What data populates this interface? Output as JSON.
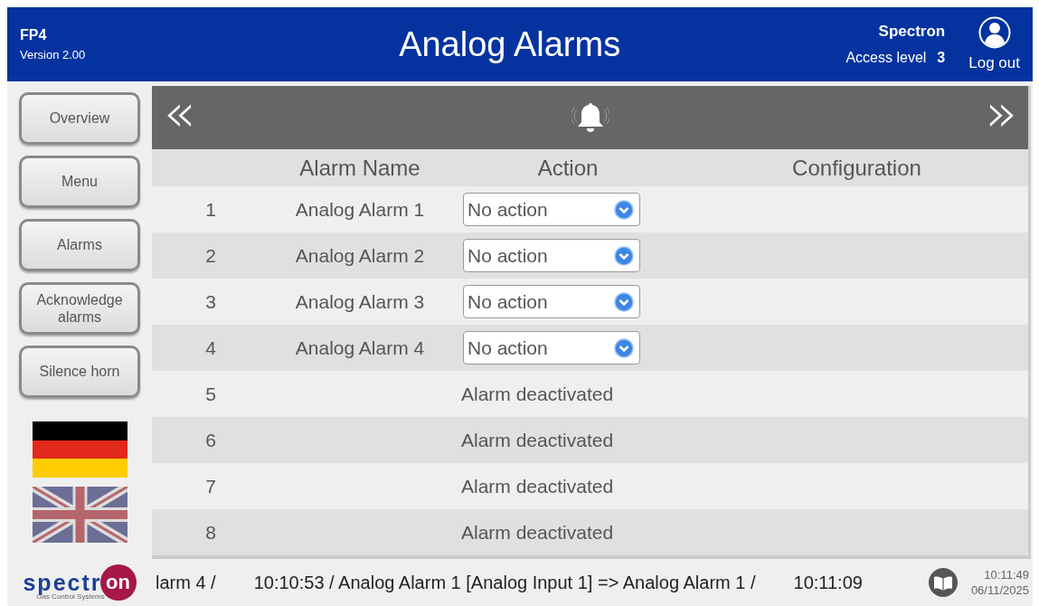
{
  "header": {
    "device": "FP4",
    "version": "Version 2.00",
    "title": "Analog Alarms",
    "user": "Spectron",
    "access_label": "Access level",
    "access_level": "3",
    "logout": "Log out"
  },
  "sidebar": {
    "buttons": [
      {
        "label": "Overview"
      },
      {
        "label": "Menu"
      },
      {
        "label": "Alarms"
      },
      {
        "label": "Acknowledge alarms"
      },
      {
        "label": "Silence horn"
      }
    ],
    "languages": [
      {
        "kind": "german",
        "selected": false
      },
      {
        "kind": "british",
        "selected": false
      }
    ],
    "logo": {
      "word": "spectr",
      "badge": "on",
      "tagline": "Gas Control Systems"
    }
  },
  "nav": {
    "prev": "«",
    "next": "»"
  },
  "table": {
    "columns": [
      "Alarm Name",
      "Action",
      "Configuration"
    ],
    "rows": [
      {
        "kind": "active",
        "number": "1",
        "name": "Analog Alarm 1",
        "action": "No action"
      },
      {
        "kind": "active",
        "number": "2",
        "name": "Analog Alarm 2",
        "action": "No action"
      },
      {
        "kind": "active",
        "number": "3",
        "name": "Analog Alarm 3",
        "action": "No action"
      },
      {
        "kind": "active",
        "number": "4",
        "name": "Analog Alarm 4",
        "action": "No action"
      },
      {
        "kind": "deactivated",
        "number": "5",
        "status": "Alarm deactivated"
      },
      {
        "kind": "deactivated",
        "number": "6",
        "status": "Alarm deactivated"
      },
      {
        "kind": "deactivated",
        "number": "7",
        "status": "Alarm deactivated"
      },
      {
        "kind": "deactivated",
        "number": "8",
        "status": "Alarm deactivated"
      }
    ]
  },
  "status_bar": {
    "messages": [
      "larm 4 /",
      "10:10:53 / Analog Alarm 1 [Analog Input 1] => Analog Alarm 1 /",
      "10:11:09"
    ],
    "time": "10:11:49",
    "date": "06/11/2025"
  }
}
